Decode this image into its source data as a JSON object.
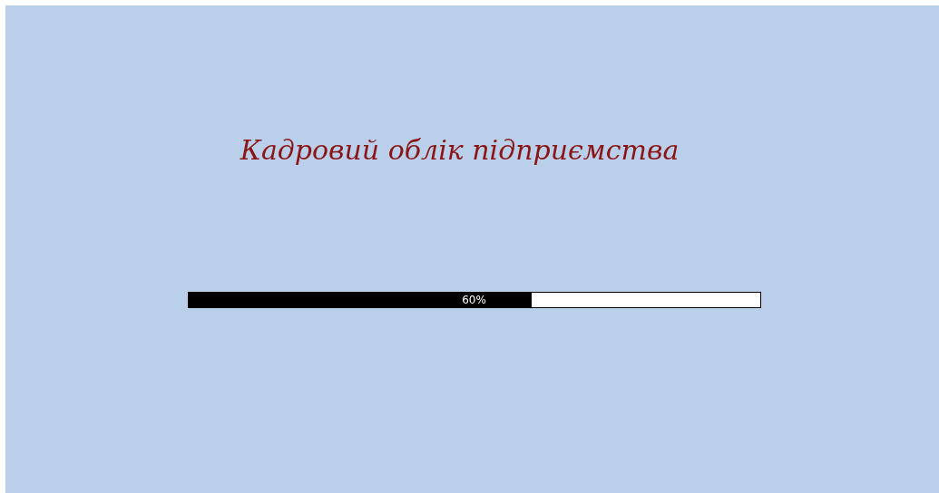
{
  "title": "Кадровий облік підприємства",
  "progress": {
    "level": 0.6,
    "reading": "60%"
  }
}
